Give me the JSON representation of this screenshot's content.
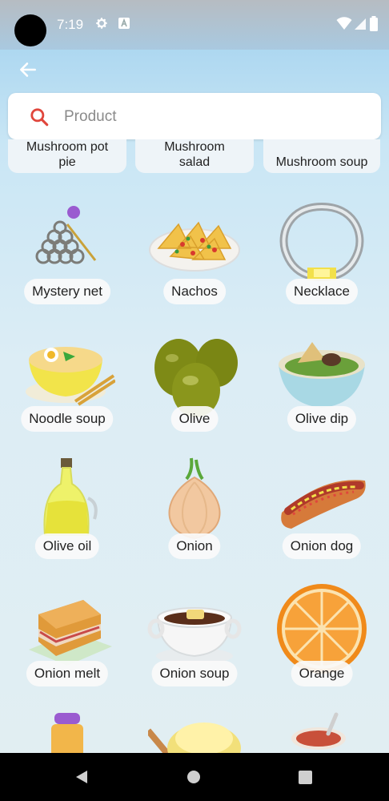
{
  "status": {
    "time": "7:19"
  },
  "search": {
    "placeholder": "Product",
    "value": ""
  },
  "partial_row": [
    {
      "label_line1": "Mushroom pot",
      "label_line2": "pie"
    },
    {
      "label_line1": "Mushroom",
      "label_line2": "salad"
    },
    {
      "label": "Mushroom soup"
    }
  ],
  "items": [
    {
      "label": "Mystery net",
      "icon": "mystery-net-icon"
    },
    {
      "label": "Nachos",
      "icon": "nachos-icon"
    },
    {
      "label": "Necklace",
      "icon": "necklace-icon"
    },
    {
      "label": "Noodle soup",
      "icon": "noodle-soup-icon"
    },
    {
      "label": "Olive",
      "icon": "olive-icon"
    },
    {
      "label": "Olive dip",
      "icon": "olive-dip-icon"
    },
    {
      "label": "Olive oil",
      "icon": "olive-oil-icon"
    },
    {
      "label": "Onion",
      "icon": "onion-icon"
    },
    {
      "label": "Onion dog",
      "icon": "onion-dog-icon"
    },
    {
      "label": "Onion melt",
      "icon": "onion-melt-icon"
    },
    {
      "label": "Onion soup",
      "icon": "onion-soup-icon"
    },
    {
      "label": "Orange",
      "icon": "orange-icon"
    }
  ],
  "colors": {
    "search_icon": "#e0463c",
    "statusbar": "#b6bcc2"
  }
}
